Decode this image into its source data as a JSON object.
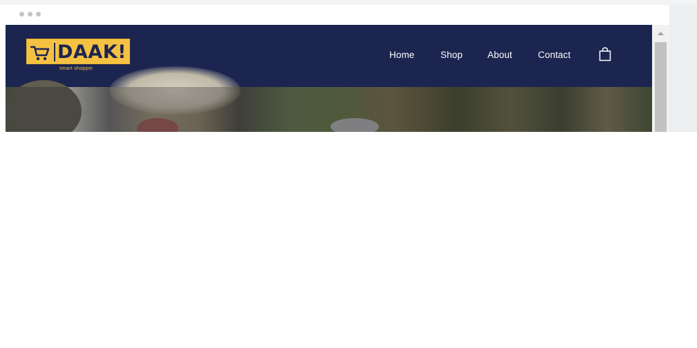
{
  "brand": {
    "name": "DAAK!",
    "tagline": "smart shopper",
    "colors": {
      "navy": "#1b2550",
      "yellow": "#f5c142"
    }
  },
  "nav": {
    "items": [
      {
        "label": "Home"
      },
      {
        "label": "Shop"
      },
      {
        "label": "About"
      },
      {
        "label": "Contact"
      }
    ],
    "cart_icon": "shopping-bag-icon"
  },
  "browser": {
    "window_controls": [
      "dot",
      "dot",
      "dot"
    ]
  }
}
